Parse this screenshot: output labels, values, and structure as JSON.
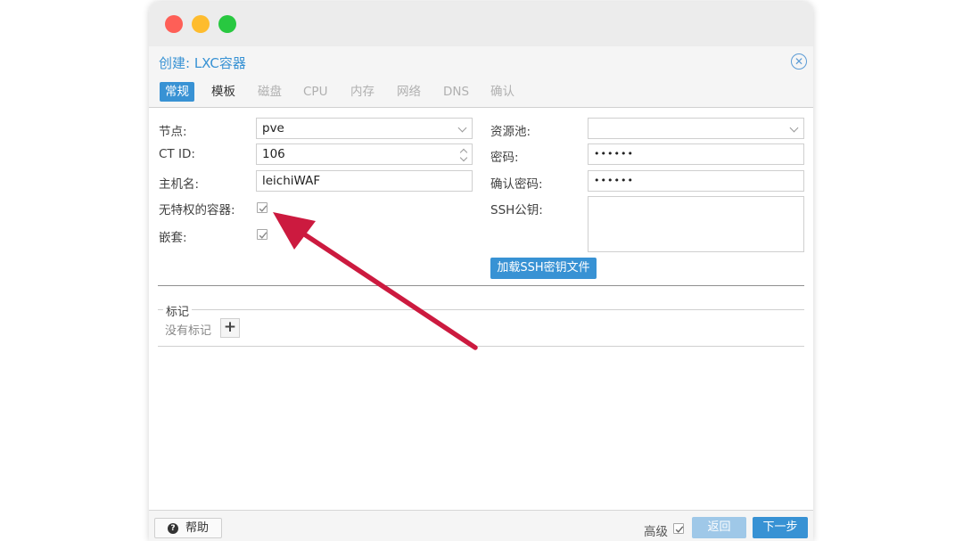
{
  "dialog": {
    "title": "创建: LXC容器",
    "close_icon": "close-circle-icon"
  },
  "tabs": [
    {
      "label": "常规",
      "state": "active"
    },
    {
      "label": "模板",
      "state": "enabled"
    },
    {
      "label": "磁盘",
      "state": "disabled"
    },
    {
      "label": "CPU",
      "state": "disabled"
    },
    {
      "label": "内存",
      "state": "disabled"
    },
    {
      "label": "网络",
      "state": "disabled"
    },
    {
      "label": "DNS",
      "state": "disabled"
    },
    {
      "label": "确认",
      "state": "disabled"
    }
  ],
  "form": {
    "node_label": "节点:",
    "node_value": "pve",
    "ctid_label": "CT ID:",
    "ctid_value": "106",
    "hostname_label": "主机名:",
    "hostname_value": "leichiWAF",
    "unprivileged_label": "无特权的容器:",
    "unprivileged_checked": true,
    "nesting_label": "嵌套:",
    "nesting_checked": true,
    "pool_label": "资源池:",
    "pool_value": "",
    "password_label": "密码:",
    "password_value": "••••••",
    "confirm_password_label": "确认密码:",
    "confirm_password_value": "••••••",
    "ssh_key_label": "SSH公钥:",
    "ssh_key_value": "",
    "load_ssh_button": "加载SSH密钥文件"
  },
  "tags": {
    "legend": "标记",
    "empty_text": "没有标记",
    "add_icon": "plus-icon"
  },
  "footer": {
    "help_label": "帮助",
    "advanced_label": "高级",
    "advanced_checked": true,
    "back_label": "返回",
    "next_label": "下一步"
  },
  "colors": {
    "accent": "#3892d4",
    "annotation_arrow": "#cc1a3f"
  }
}
